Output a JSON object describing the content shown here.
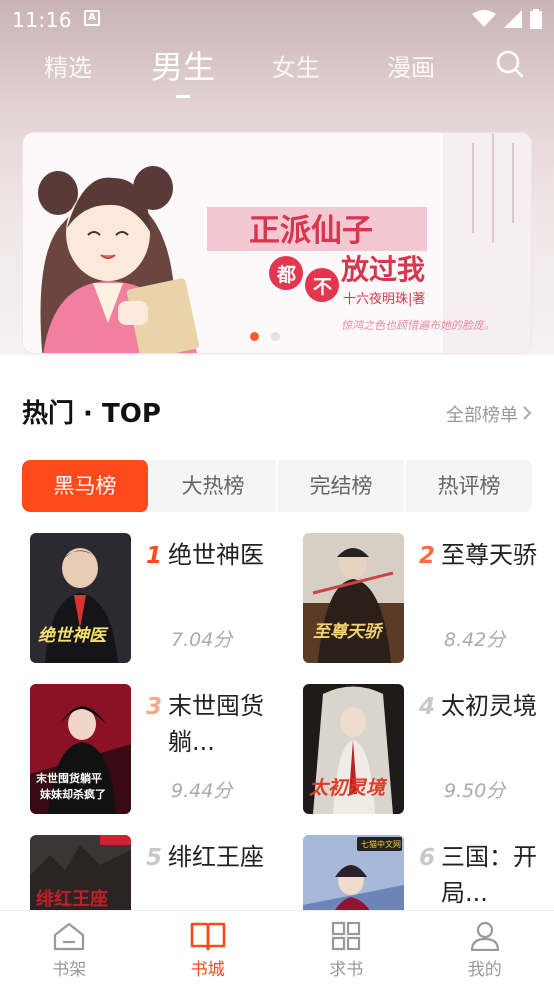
{
  "status_bar": {
    "time": "11:16",
    "notification_glyph": "A"
  },
  "nav": {
    "tabs": [
      {
        "label": "精选"
      },
      {
        "label": "男生",
        "active": true
      },
      {
        "label": "女生"
      },
      {
        "label": "漫画"
      }
    ]
  },
  "banner": {
    "title": "正派仙子",
    "tag1": "都",
    "tag2": "不",
    "title_tail": "放过我",
    "author": "十六夜明珠|著",
    "tagline": "惊鸿之色也顾惜遍布她的脸庞。",
    "active_dot": 1,
    "dot_count": 2
  },
  "section": {
    "title": "热门 · TOP",
    "more_label": "全部榜单"
  },
  "rank_tabs": [
    {
      "label": "黑马榜",
      "active": true
    },
    {
      "label": "大热榜"
    },
    {
      "label": "完结榜"
    },
    {
      "label": "热评榜"
    }
  ],
  "books": [
    {
      "rank": "1",
      "name": "绝世神医",
      "score": "7.04分",
      "cover_text": "绝世神医"
    },
    {
      "rank": "2",
      "name": "至尊天骄",
      "score": "8.42分",
      "cover_text": "至尊天骄"
    },
    {
      "rank": "3",
      "name": "末世囤货躺...",
      "score": "9.44分",
      "cover_text": "末世囤货躺平 妹妹却杀疯了"
    },
    {
      "rank": "4",
      "name": "太初灵境",
      "score": "9.50分",
      "cover_text": "太初灵境"
    },
    {
      "rank": "5",
      "name": "绯红王座",
      "score": "",
      "cover_text": "绯红王座"
    },
    {
      "rank": "6",
      "name": "三国：开局...",
      "score": "",
      "cover_text": "七猫中文网"
    }
  ],
  "colors": {
    "accent": "#ff4a1c",
    "rank_top": "#ff4a1c",
    "rank_mid": "#ffa58a",
    "rank_low": "#c8c8c8"
  },
  "bottom_nav": [
    {
      "label": "书架",
      "icon": "bookshelf-icon"
    },
    {
      "label": "书城",
      "icon": "book-open-icon",
      "active": true
    },
    {
      "label": "求书",
      "icon": "grid-icon"
    },
    {
      "label": "我的",
      "icon": "person-icon"
    }
  ]
}
